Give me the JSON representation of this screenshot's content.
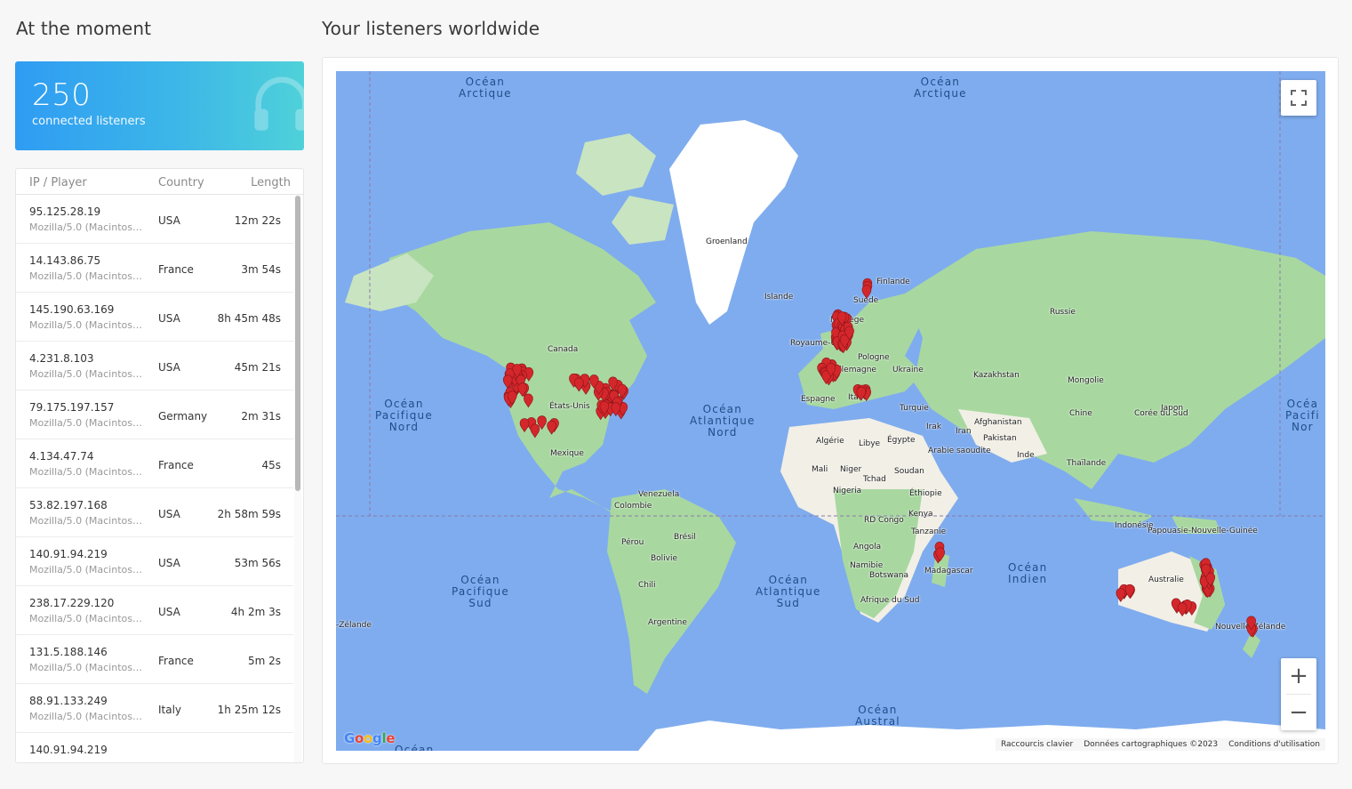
{
  "left_title": "At the moment",
  "right_title": "Your listeners worldwide",
  "stat": {
    "number": "250",
    "label": "connected listeners",
    "icon": "headphones-icon"
  },
  "table": {
    "headers": {
      "ip": "IP / Player",
      "country": "Country",
      "length": "Length"
    },
    "rows": [
      {
        "ip": "95.125.28.19",
        "ua": "Mozilla/5.0 (Macintosh;...",
        "country": "USA",
        "length": "12m 22s"
      },
      {
        "ip": "14.143.86.75",
        "ua": "Mozilla/5.0 (Macintosh;...",
        "country": "France",
        "length": "3m 54s"
      },
      {
        "ip": "145.190.63.169",
        "ua": "Mozilla/5.0 (Macintosh;...",
        "country": "USA",
        "length": "8h 45m 48s"
      },
      {
        "ip": "4.231.8.103",
        "ua": "Mozilla/5.0 (Macintosh;...",
        "country": "USA",
        "length": "45m 21s"
      },
      {
        "ip": "79.175.197.157",
        "ua": "Mozilla/5.0 (Macintosh;...",
        "country": "Germany",
        "length": "2m 31s"
      },
      {
        "ip": "4.134.47.74",
        "ua": "Mozilla/5.0 (Macintosh;...",
        "country": "France",
        "length": "45s"
      },
      {
        "ip": "53.82.197.168",
        "ua": "Mozilla/5.0 (Macintosh;...",
        "country": "USA",
        "length": "2h 58m 59s"
      },
      {
        "ip": "140.91.94.219",
        "ua": "Mozilla/5.0 (Macintosh;...",
        "country": "USA",
        "length": "53m 56s"
      },
      {
        "ip": "238.17.229.120",
        "ua": "Mozilla/5.0 (Macintosh;...",
        "country": "USA",
        "length": "4h 2m 3s"
      },
      {
        "ip": "131.5.188.146",
        "ua": "Mozilla/5.0 (Macintosh;...",
        "country": "France",
        "length": "5m 2s"
      },
      {
        "ip": "88.91.133.249",
        "ua": "Mozilla/5.0 (Macintosh;...",
        "country": "Italy",
        "length": "1h 25m 12s"
      },
      {
        "ip": "140.91.94.219",
        "ua": "",
        "country": "",
        "length": ""
      }
    ]
  },
  "map": {
    "oceans": [
      {
        "id": "ocean-arctique-1",
        "text": "Océan\nArctique"
      },
      {
        "id": "ocean-arctique-2",
        "text": "Océan\nArctique"
      },
      {
        "id": "ocean-pacifique-nord",
        "text": "Océan\nPacifique\nNord"
      },
      {
        "id": "ocean-atlantique-nord",
        "text": "Océan\nAtlantique\nNord"
      },
      {
        "id": "ocean-pacifique-nord-2",
        "text": "Océa\nPacifi\nNor"
      },
      {
        "id": "ocean-pacifique-sud",
        "text": "Océan\nPacifique\nSud"
      },
      {
        "id": "ocean-atlantique-sud",
        "text": "Océan\nAtlantique\nSud"
      },
      {
        "id": "ocean-indien",
        "text": "Océan\nIndien"
      },
      {
        "id": "ocean-austral",
        "text": "Océan\nAustral"
      },
      {
        "id": "ocean-bottom",
        "text": "Océan"
      }
    ],
    "places": [
      "Groenland",
      "Islande",
      "Finlande",
      "Suède",
      "Norvège",
      "Royaume-Uni",
      "Allemagne",
      "Pologne",
      "Ukraine",
      "Russie",
      "Kazakhstan",
      "Mongolie",
      "Chine",
      "Corée du Sud",
      "Japon",
      "Canada",
      "États-Unis",
      "Mexique",
      "Espagne",
      "Italie",
      "Turquie",
      "Irak",
      "Iran",
      "Afghanistan",
      "Pakistan",
      "Inde",
      "Thaïlande",
      "Algérie",
      "Libye",
      "Égypte",
      "Arabie saoudite",
      "Mali",
      "Niger",
      "Tchad",
      "Soudan",
      "Nigeria",
      "Éthiopie",
      "RD Congo",
      "Kenya",
      "Tanzanie",
      "Angola",
      "Namibie",
      "Botswana",
      "Afrique du Sud",
      "Madagascar",
      "Venezuela",
      "Colombie",
      "Brésil",
      "Pérou",
      "Bolivie",
      "Chili",
      "Argentine",
      "Indonésie",
      "Papouasie-Nouvelle-Guinée",
      "Australie",
      "Nouvelle-Zélande",
      "-Zélande"
    ],
    "google": "Google",
    "attribution": [
      "Raccourcis clavier",
      "Données cartographiques ©2023",
      "Conditions d'utilisation"
    ],
    "zoom_in": "+",
    "zoom_out": "−",
    "colors": {
      "water": "#7facee",
      "land": "#a8d8a0",
      "desert": "#f2efe6",
      "ice": "#ffffff",
      "marker": "#d4272b"
    }
  }
}
